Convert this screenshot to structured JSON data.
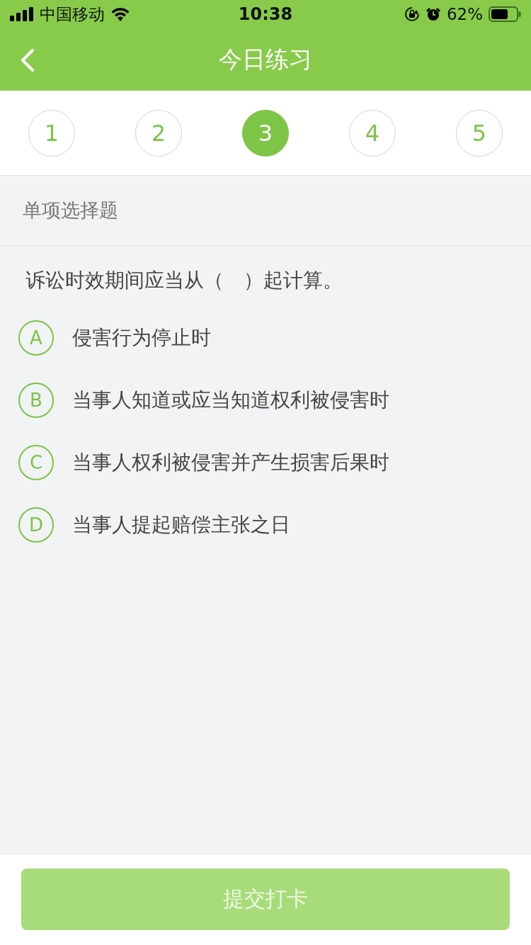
{
  "status_bar": {
    "carrier": "中国移动",
    "time": "10:38",
    "battery_percent": "62%"
  },
  "nav": {
    "title": "今日练习"
  },
  "question_tabs": [
    {
      "label": "1",
      "selected": false
    },
    {
      "label": "2",
      "selected": false
    },
    {
      "label": "3",
      "selected": true
    },
    {
      "label": "4",
      "selected": false
    },
    {
      "label": "5",
      "selected": false
    }
  ],
  "question_type": "单项选择题",
  "question": "诉讼时效期间应当从（　）起计算。",
  "options": [
    {
      "letter": "A",
      "text": "侵害行为停止时",
      "selected": false
    },
    {
      "letter": "B",
      "text": "当事人知道或应当知道权利被侵害时",
      "selected": false
    },
    {
      "letter": "C",
      "text": "当事人权利被侵害并产生损害后果时",
      "selected": false
    },
    {
      "letter": "D",
      "text": "当事人提起赔偿主张之日",
      "selected": false
    }
  ],
  "submit_button": {
    "label": "提交打卡",
    "disabled": true
  }
}
